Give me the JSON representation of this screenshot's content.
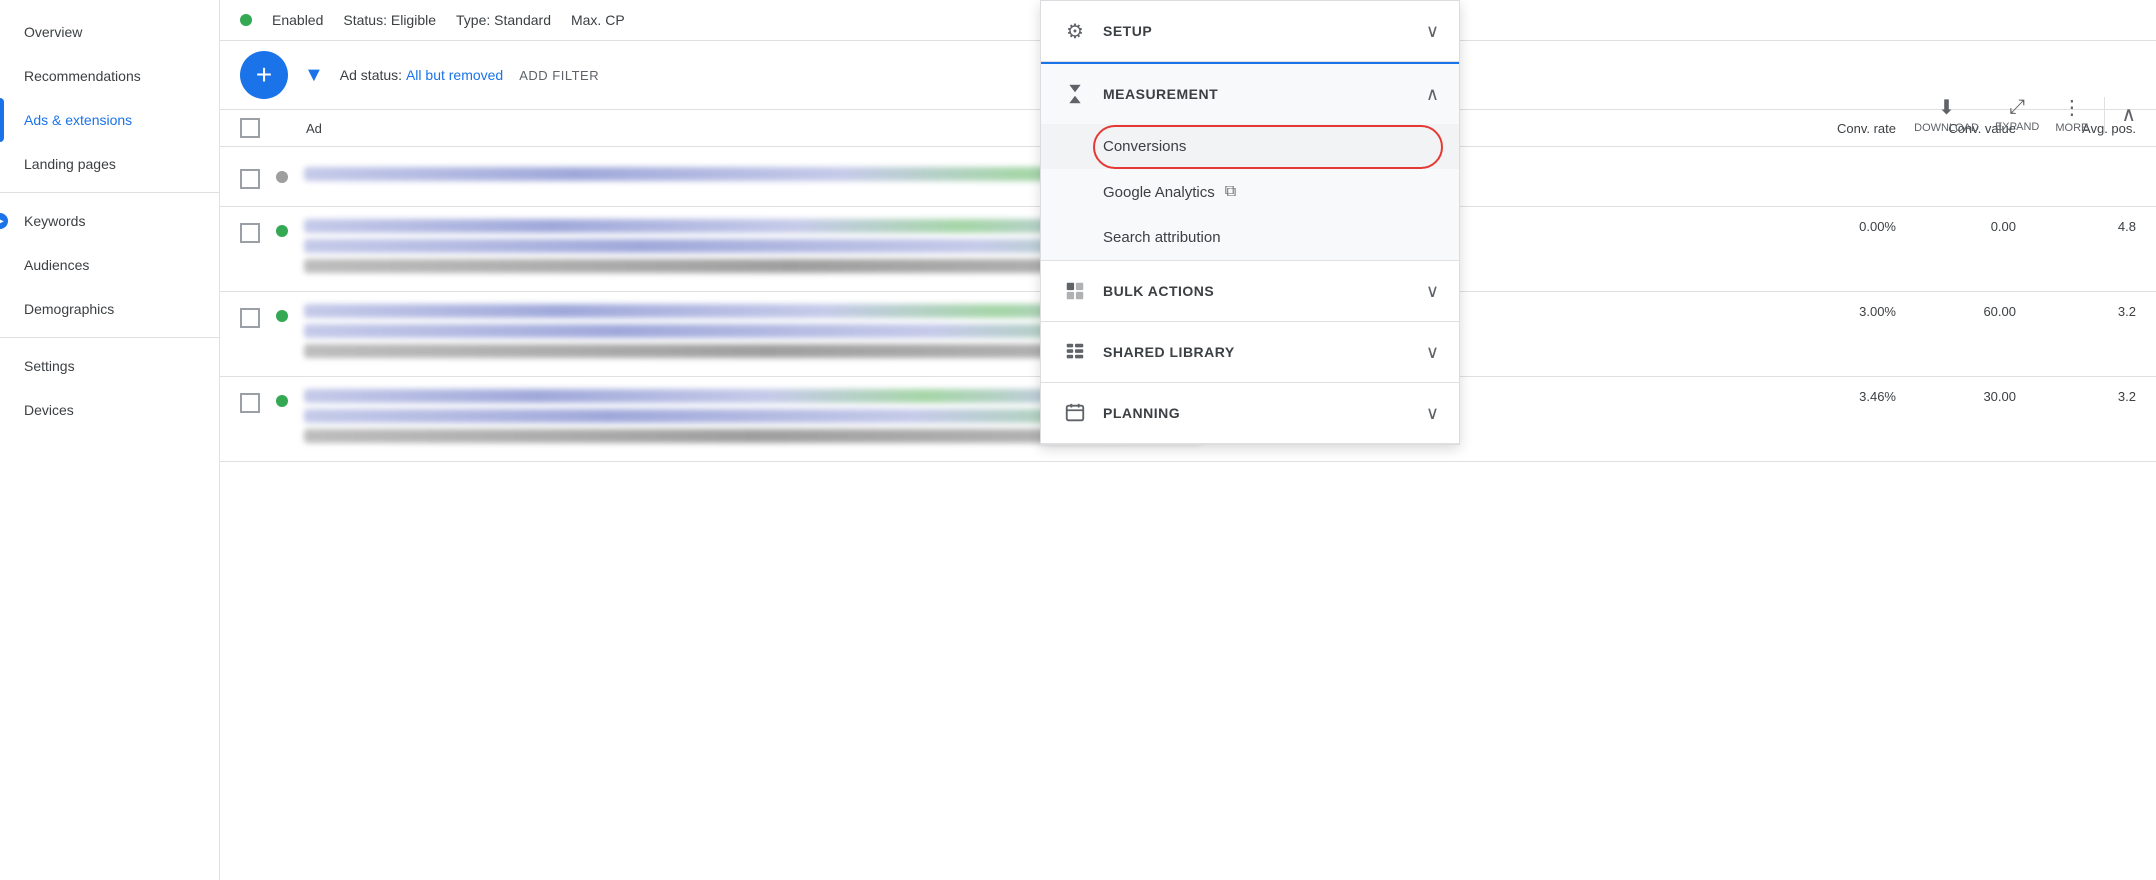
{
  "sidebar": {
    "items": [
      {
        "label": "Overview",
        "active": false
      },
      {
        "label": "Recommendations",
        "active": false
      },
      {
        "label": "Ads & extensions",
        "active": true
      },
      {
        "label": "Landing pages",
        "active": false
      },
      {
        "label": "Keywords",
        "active": false
      },
      {
        "label": "Audiences",
        "active": false
      },
      {
        "label": "Demographics",
        "active": false
      },
      {
        "label": "Settings",
        "active": false
      },
      {
        "label": "Devices",
        "active": false
      }
    ]
  },
  "topbar": {
    "enabled": "Enabled",
    "status_label": "Status:",
    "status_value": "Eligible",
    "type_label": "Type:",
    "type_value": "Standard",
    "max_cp": "Max. CP"
  },
  "filterbar": {
    "add_btn": "+",
    "ad_status_label": "Ad status:",
    "ad_status_value": "All but removed",
    "add_filter": "ADD FILTER"
  },
  "table": {
    "header": {
      "ad": "Ad",
      "conv_rate": "Conv. rate",
      "conv_value": "Conv. value",
      "avg_pos": "Avg. pos."
    },
    "rows": [
      {
        "rate": "0.00%",
        "value": "0.00",
        "avg": "4.8"
      },
      {
        "rate": "3.00%",
        "value": "60.00",
        "avg": "3.2"
      },
      {
        "rate": "3.46%",
        "value": "30.00",
        "avg": "3.2"
      }
    ]
  },
  "toolbar": {
    "download": "DOWNLOAD",
    "expand": "EXPAND",
    "more": "MORE"
  },
  "dropdown": {
    "setup": {
      "title": "SETUP",
      "expanded": false
    },
    "measurement": {
      "title": "MEASUREMENT",
      "expanded": true,
      "items": [
        {
          "label": "Conversions",
          "highlighted": true,
          "has_oval": true
        },
        {
          "label": "Google Analytics",
          "has_external": true
        },
        {
          "label": "Search attribution",
          "has_external": false
        }
      ]
    },
    "bulk_actions": {
      "title": "BULK ACTIONS",
      "expanded": false
    },
    "shared_library": {
      "title": "SHARED LIBRARY",
      "expanded": false
    },
    "planning": {
      "title": "PLANNING",
      "expanded": false
    }
  }
}
